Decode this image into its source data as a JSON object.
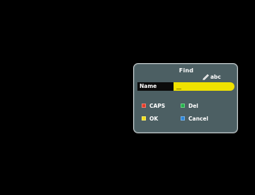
{
  "dialog": {
    "title": "Find",
    "mode": "abc",
    "name_label": "Name",
    "name_value": ""
  },
  "keys": {
    "caps": {
      "label": "CAPS",
      "color": "#e83a26"
    },
    "del": {
      "label": "Del",
      "color": "#22b34a"
    },
    "ok": {
      "label": "OK",
      "color": "#f2dd18"
    },
    "cancel": {
      "label": "Cancel",
      "color": "#2b86d9"
    }
  },
  "icons": {
    "mode": "pencil-icon"
  }
}
